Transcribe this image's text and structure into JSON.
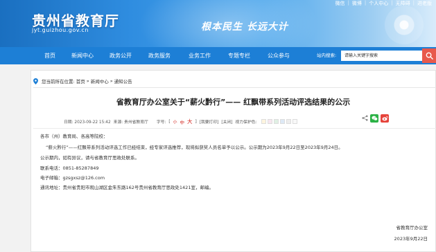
{
  "header": {
    "site_title": "贵州省教育厅",
    "site_url": "jyt.guizhou.gov.cn",
    "slogan": "根本民生 长远大计",
    "top_links": [
      "微信",
      "微博",
      "个人中心",
      "无障碍",
      "进老版"
    ]
  },
  "nav": {
    "items": [
      "首页",
      "新闻中心",
      "政务公开",
      "政务服务",
      "业务工作",
      "专题专栏",
      "公众参与"
    ],
    "search_label": "站内搜索:",
    "search_placeholder": "请输入关键字搜索"
  },
  "breadcrumb": {
    "prefix": "您当前所在位置:",
    "items": [
      "首页",
      "新闻中心",
      "通知公告"
    ],
    "separator": "»"
  },
  "article": {
    "title": "省教育厅办公室关于“薪火黔行”—— 红飘带系列活动评选结果的公示",
    "meta": {
      "date": "日期: 2023-09-22 15:42",
      "source": "来源: 贵州省教育厅",
      "font_label": "字号:",
      "font_open": "[",
      "font_small": "小",
      "font_mid": "中",
      "font_large": "大",
      "font_close": "]",
      "print": "[我要打印]",
      "close": "[关闭]",
      "protect_label": "视力保护色:",
      "swatch_colors": [
        "#fef5de",
        "#f7e6ef",
        "#e0f0e4",
        "#dde9f6",
        "#ededed",
        "#f8f8f8"
      ]
    },
    "share": {
      "icons": [
        "share-icon",
        "wechat-icon",
        "weibo-icon"
      ],
      "wechat_color": "#2bb246",
      "weibo_color": "#e6443c"
    },
    "paragraphs": [
      "各市（州）教育局、各高等院校：",
      "“薪火黔行”——红飘带系列活动评选工作已经结束，经专家评选推荐，现将拟获奖人员名单予以公示。公示期为2023年9月22日至2023年9月24日。",
      "公示期内，如有异议，请与省教育厅思政处联系。",
      "联系电话：0851-85287849",
      "电子邮箱：gzsgxsz@126.com",
      "通讯地址：贵州省贵阳市观山湖区金朱东路162号贵州省教育厅思政处1421室，邮编。"
    ],
    "signature": {
      "org": "省教育厅办公室",
      "date": "2023年9月22日"
    }
  },
  "colors": {
    "nav_bg": "#1d7fd6",
    "search_button": "#e8594c",
    "accent_red": "#d2231c"
  }
}
